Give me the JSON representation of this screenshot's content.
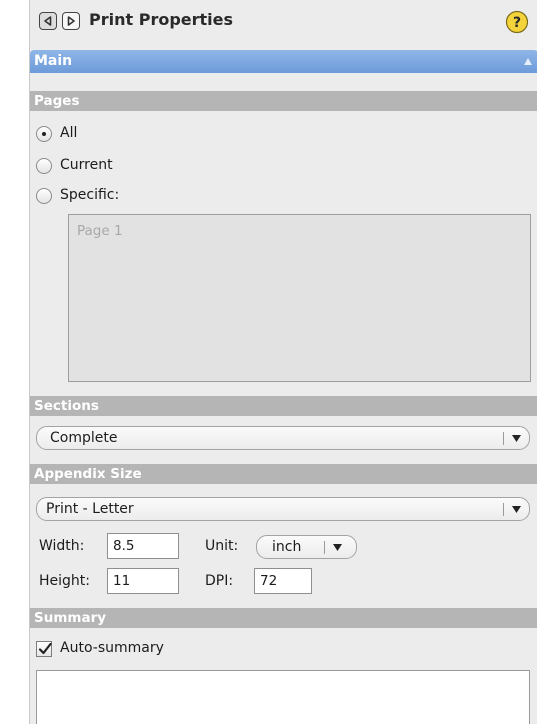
{
  "window": {
    "title": "Print Properties",
    "back_icon": "triangle-left-icon",
    "forward_icon": "triangle-right-icon",
    "help_label": "?"
  },
  "main_section": {
    "label": "Main",
    "expanded": true
  },
  "pages_section": {
    "label": "Pages",
    "options": [
      {
        "label": "All",
        "checked": true
      },
      {
        "label": "Current",
        "checked": false
      },
      {
        "label": "Specific:",
        "checked": false
      }
    ],
    "specific_placeholder": "Page 1"
  },
  "sections_section": {
    "label": "Sections",
    "selected": "Complete"
  },
  "appendix_size_section": {
    "label": "Appendix Size",
    "selected": "Print - Letter",
    "width_label": "Width:",
    "width_value": "8.5",
    "unit_label": "Unit:",
    "unit_value": "inch",
    "height_label": "Height:",
    "height_value": "11",
    "dpi_label": "DPI:",
    "dpi_value": "72"
  },
  "summary_section": {
    "label": "Summary",
    "auto_summary_label": "Auto-summary",
    "auto_summary_checked": true,
    "summary_text": ""
  },
  "colors": {
    "accent_header": "#7ea8e0",
    "section_header": "#b5b5b5",
    "panel_bg": "#ececec",
    "help_yellow": "#f5d33a"
  }
}
